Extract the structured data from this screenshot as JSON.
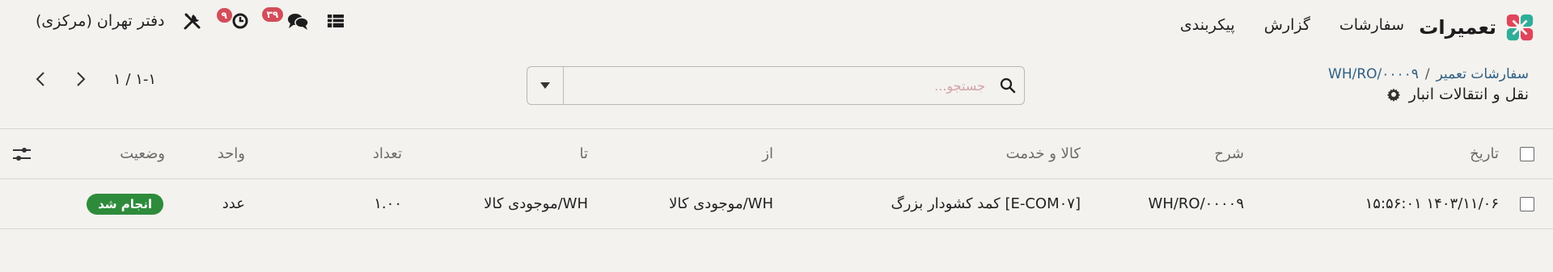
{
  "brand": {
    "name": "تعمیرات"
  },
  "menu": [
    "سفارشات",
    "گزارش",
    "پیکربندی"
  ],
  "systray": {
    "company": "دفتر تهران (مرکزی)",
    "activity_badge": "۹",
    "messages_badge": "۳۹"
  },
  "breadcrumb": {
    "parent": "سفارشات تعمیر",
    "separator": "/",
    "current": "WH/RO/۰۰۰۰۹"
  },
  "page_title": "نقل و انتقالات انبار",
  "search": {
    "placeholder": "جستجو..."
  },
  "pager": {
    "value": "۱-۱ / ۱"
  },
  "table": {
    "columns": {
      "date": "تاریخ",
      "reference": "شرح",
      "product": "کالا و خدمت",
      "from": "از",
      "to": "تا",
      "quantity": "تعداد",
      "uom": "واحد",
      "status": "وضعیت"
    },
    "rows": [
      {
        "date": "۱۴۰۳/۱۱/۰۶ ۱۵:۵۶:۰۱",
        "reference": "WH/RO/۰۰۰۰۹",
        "product": "[E-COM۰۷] کمد کشودار بزرگ",
        "from": "WH/موجودی کالا",
        "to": "WH/موجودی کالا",
        "quantity": "۱.۰۰",
        "uom": "عدد",
        "status": "انجام شد"
      }
    ]
  },
  "colors": {
    "badge": "#d44c59",
    "status_done": "#2e8b3b",
    "breadcrumb": "#2f5f85",
    "background": "#f3f2ee"
  }
}
